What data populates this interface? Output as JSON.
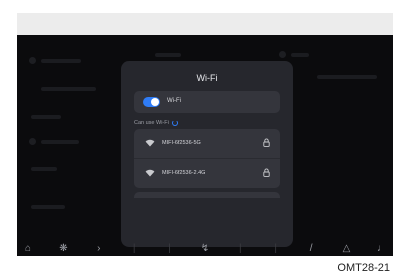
{
  "wifi_panel": {
    "title": "Wi-Fi",
    "toggle_label": "Wi-Fi",
    "toggle_state": "on",
    "section_label": "Can use Wi-Fi",
    "networks": [
      {
        "name": "MIFI-6f2536-5G",
        "secured": true
      },
      {
        "name": "MIFI-6f2536-2.4G",
        "secured": true
      }
    ]
  },
  "figure_caption": "OMT28-21",
  "colors": {
    "accent": "#2f7cf6",
    "panel": "#26272d",
    "card": "#34353c",
    "screen": "#0b0b0d"
  },
  "icons": [
    "wifi-icon",
    "lock-icon",
    "refresh-spinner-icon",
    "home-icon",
    "fan-icon",
    "seat-icon",
    "bell-icon",
    "triangle-icon"
  ]
}
